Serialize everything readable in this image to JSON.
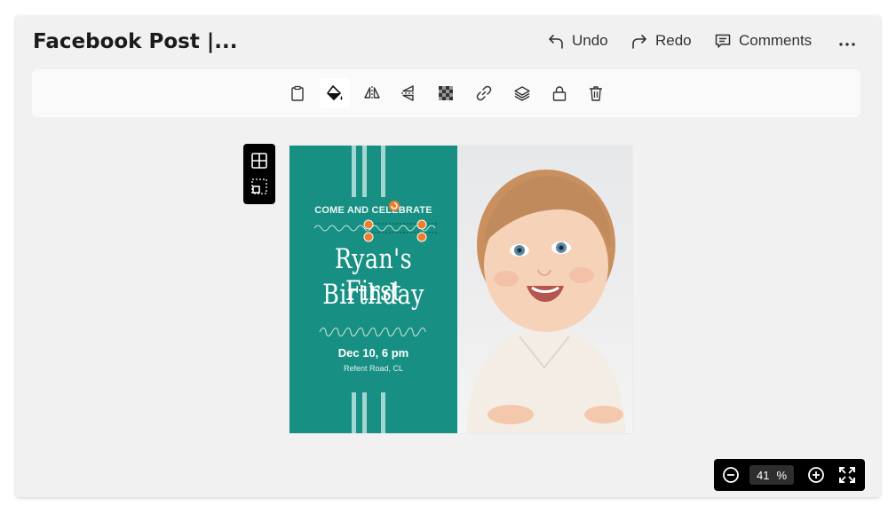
{
  "header": {
    "title": "Facebook Post |...",
    "undo_label": "Undo",
    "redo_label": "Redo",
    "comments_label": "Comments"
  },
  "toolbar": {
    "icons": [
      "clipboard-icon",
      "fill-bucket-icon",
      "flip-horizontal-icon",
      "flip-vertical-icon",
      "transparency-icon",
      "link-icon",
      "layers-icon",
      "lock-icon",
      "trash-icon"
    ],
    "active": "fill-bucket-icon"
  },
  "canvas": {
    "heading": "COME AND CELEBRATE",
    "name_line1": "Ryan's First",
    "name_line2": "Birthday",
    "date": "Dec 10, 6 pm",
    "place": "Refent Road, CL",
    "card_color": "#178f82",
    "stripe_color": "#a4d6d1",
    "handle_color": "#ee7d2c"
  },
  "zoom": {
    "value": "41",
    "unit": "%"
  }
}
